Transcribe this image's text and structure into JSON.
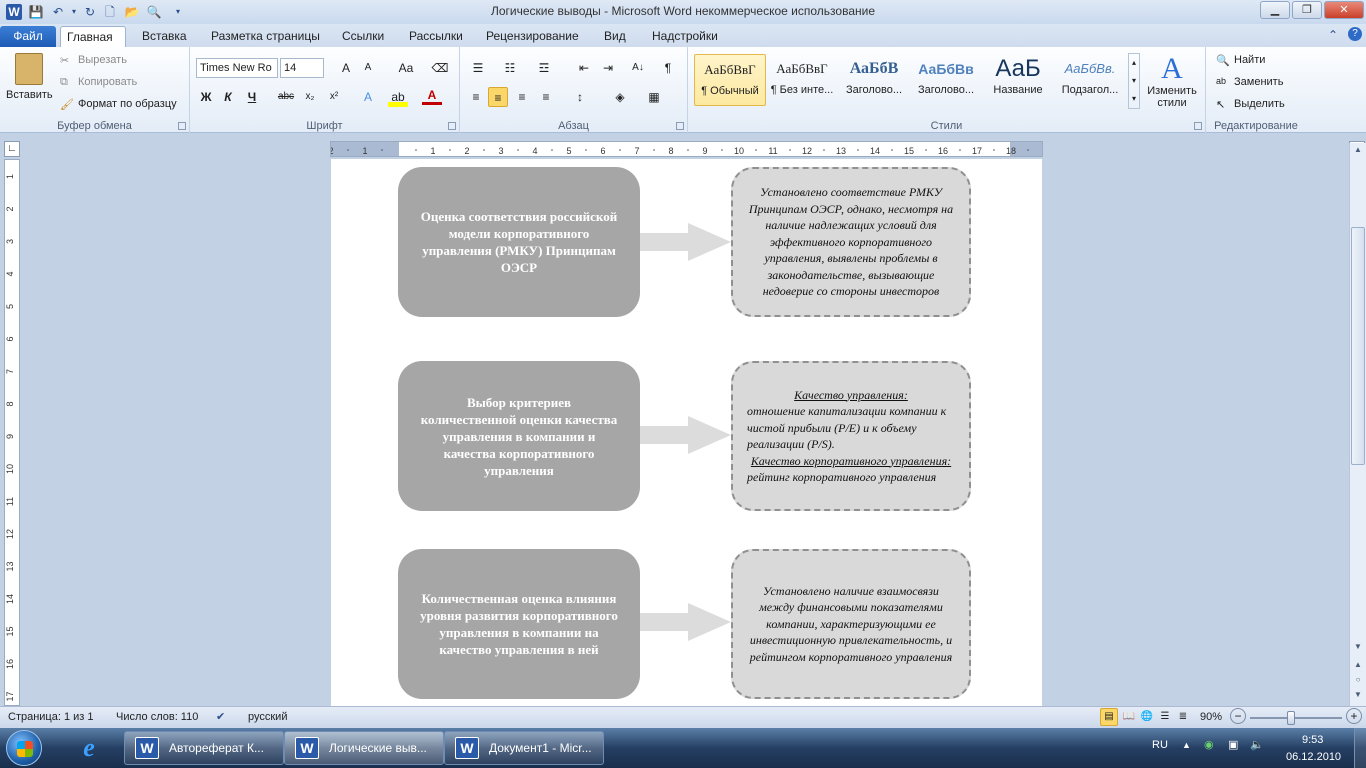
{
  "window": {
    "title": "Логические выводы  -  Microsoft Word некоммерческое использование"
  },
  "tabs": [
    "Файл",
    "Главная",
    "Вставка",
    "Разметка страницы",
    "Ссылки",
    "Рассылки",
    "Рецензирование",
    "Вид",
    "Надстройки"
  ],
  "clipboard": {
    "paste": "Вставить",
    "cut": "Вырезать",
    "copy": "Копировать",
    "format_painter": "Формат по образцу",
    "label": "Буфер обмена"
  },
  "font": {
    "name": "Times New Ro",
    "size": "14",
    "label": "Шрифт",
    "bold": "Ж",
    "italic": "К",
    "underline": "Ч",
    "strike": "abc"
  },
  "paragraph": {
    "label": "Абзац"
  },
  "styles": {
    "label": "Стили",
    "items": [
      {
        "preview": "АаБбВвГ",
        "name": "¶ Обычный"
      },
      {
        "preview": "АаБбВвГ",
        "name": "¶ Без инте..."
      },
      {
        "preview": "АаБбВ",
        "name": "Заголово..."
      },
      {
        "preview": "АаБбВв",
        "name": "Заголово..."
      },
      {
        "preview": "АаБ",
        "name": "Название"
      },
      {
        "preview": "АаБбВв.",
        "name": "Подзагол..."
      }
    ],
    "change": "Изменить стили"
  },
  "editing": {
    "find": "Найти",
    "replace": "Заменить",
    "select": "Выделить",
    "label": "Редактирование"
  },
  "diagram": {
    "rows": [
      {
        "left": "Оценка соответствия российской модели корпоративного управления (РМКУ) Принципам ОЭСР",
        "right": "Установлено соответствие РМКУ Принципам ОЭСР, однако, несмотря на наличие надлежащих условий для эффективного корпоративного управления, выявлены проблемы в законодательстве, вызывающие недоверие со стороны инвесторов"
      },
      {
        "left": "Выбор критериев количественной оценки качества управления в компании и качества корпоративного управления",
        "right_h1": "Качество управления:",
        "right_t1": "отношение капитализации компании к чистой прибыли (P/E) и к объему реализации (P/S).",
        "right_h2": "Качество корпоративного управления:",
        "right_t2": "рейтинг корпоративного управления"
      },
      {
        "left": "Количественная оценка влияния уровня развития корпоративного управления в компании на качество управления в ней",
        "right": "Установлено наличие взаимосвязи между финансовыми показателями компании, характеризующими ее инвестиционную привлекательность, и рейтингом корпоративного управления"
      }
    ]
  },
  "status": {
    "page": "Страница: 1 из 1",
    "words": "Число слов: 110",
    "lang": "русский",
    "zoom": "90%"
  },
  "taskbar": {
    "items": [
      "Автореферат К...",
      "Логические выв...",
      "Документ1 - Micr..."
    ],
    "locale": "RU",
    "time": "9:53",
    "date": "06.12.2010"
  }
}
